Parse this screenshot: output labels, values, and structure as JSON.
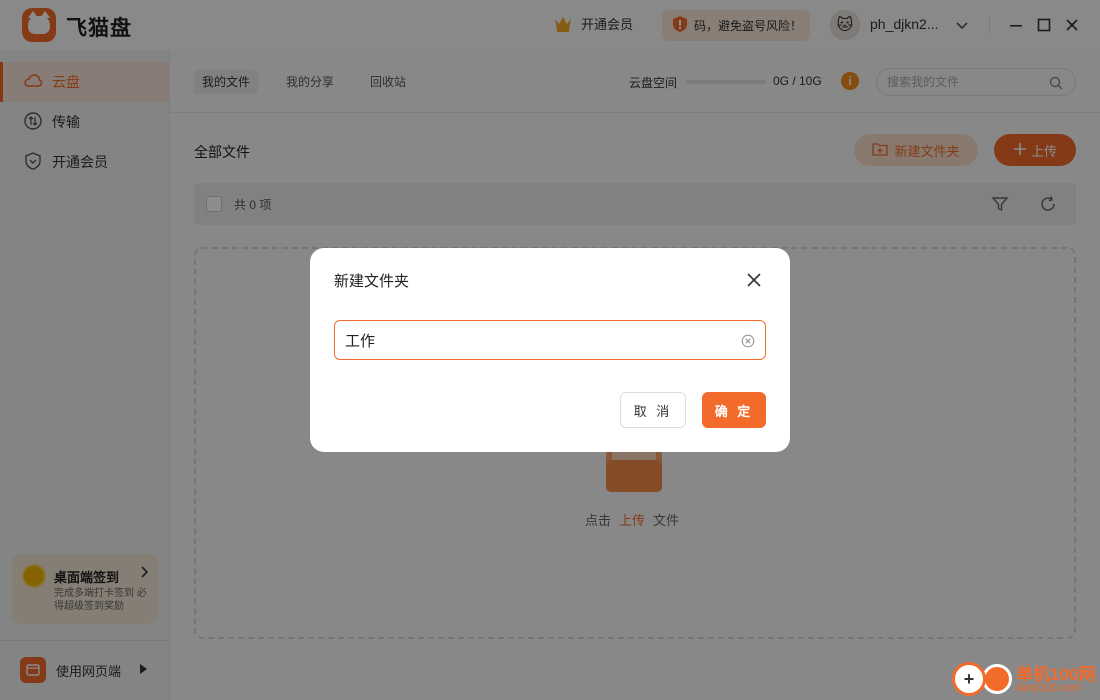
{
  "app": {
    "title": "飞猫盘"
  },
  "titlebar": {
    "vip_label": "开通会员",
    "warning_text": "码，避免盗号风险！",
    "username": "ph_djkn2..."
  },
  "sidebar": {
    "items": [
      {
        "label": "云盘",
        "icon": "cloud-icon",
        "active": true
      },
      {
        "label": "传输",
        "icon": "transfer-icon",
        "active": false
      },
      {
        "label": "开通会员",
        "icon": "vip-shield-icon",
        "active": false
      }
    ],
    "checkin": {
      "title": "桌面端签到",
      "subtitle": "完成多端打卡签到 必得超级签到奖励"
    },
    "web_entry": "使用网页端"
  },
  "main": {
    "tabs": [
      {
        "label": "我的文件",
        "active": true
      },
      {
        "label": "我的分享",
        "active": false
      },
      {
        "label": "回收站",
        "active": false
      }
    ],
    "space_label": "云盘空间",
    "space_value": "0G / 10G",
    "search_placeholder": "搜索我的文件",
    "section_title": "全部文件",
    "new_folder_label": "新建文件夹",
    "upload_label": "上传",
    "count_label": "共 0 项",
    "empty_prefix": "点击",
    "empty_link": "上传",
    "empty_suffix": "文件"
  },
  "modal": {
    "title": "新建文件夹",
    "input_value": "工作",
    "cancel_label": "取 消",
    "ok_label": "确 定"
  },
  "watermark": {
    "text": "单机100网",
    "sub": "danji100.com"
  },
  "colors": {
    "accent": "#f26b2a",
    "accent_light": "#f7dccb",
    "overlay": "rgba(0,0,0,0.45)"
  }
}
